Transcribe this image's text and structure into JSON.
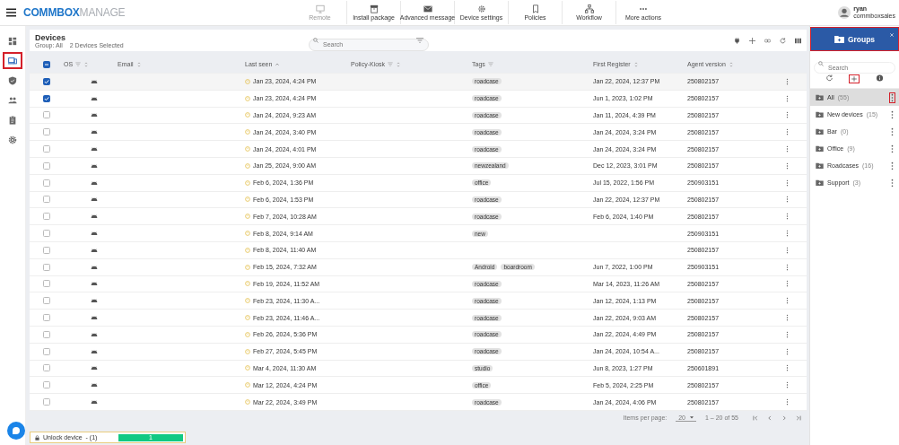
{
  "app": {
    "logo_bold": "COMMBOX",
    "logo_light": "MANAGE"
  },
  "toolbar": [
    {
      "label": "Remote",
      "disabled": true
    },
    {
      "label": "Install package",
      "disabled": false
    },
    {
      "label": "Advanced message",
      "disabled": false
    },
    {
      "label": "Device settings",
      "disabled": false
    },
    {
      "label": "Policies",
      "disabled": false
    },
    {
      "label": "Workflow",
      "disabled": false
    },
    {
      "label": "More actions",
      "disabled": false
    }
  ],
  "user": {
    "name": "ryan",
    "account": "commboxsales"
  },
  "nav": [
    {
      "selected": false,
      "highlighted": false
    },
    {
      "selected": true,
      "highlighted": true
    },
    {
      "selected": false,
      "highlighted": false
    },
    {
      "selected": false,
      "highlighted": false
    },
    {
      "selected": false,
      "highlighted": false
    },
    {
      "selected": false,
      "highlighted": false
    }
  ],
  "header": {
    "title": "Devices",
    "group": "Group: All",
    "selection": "2 Devices Selected",
    "search_placeholder": "Search"
  },
  "table": {
    "all_indeterminate": true,
    "columns": [
      {
        "label": "OS",
        "filter": true,
        "sortable": true,
        "sorted": false
      },
      {
        "label": "Email",
        "filter": false,
        "sortable": true,
        "sorted": false
      },
      {
        "label": "Last seen",
        "filter": false,
        "sortable": true,
        "sorted": true
      },
      {
        "label": "Policy-Kiosk",
        "filter": true,
        "sortable": true,
        "sorted": false
      },
      {
        "label": "Tags",
        "filter": true,
        "sortable": false,
        "sorted": false
      },
      {
        "label": "First Register",
        "filter": false,
        "sortable": true,
        "sorted": false
      },
      {
        "label": "Agent version",
        "filter": false,
        "sortable": true,
        "sorted": false
      }
    ],
    "rows": [
      {
        "checked": true,
        "last_seen": "Jan 23, 2024, 4:24 PM",
        "tags": [
          "roadcase"
        ],
        "first_register": "Jan 22, 2024, 12:37 PM",
        "agent_version": "250802157"
      },
      {
        "checked": true,
        "last_seen": "Jan 23, 2024, 4:24 PM",
        "tags": [
          "roadcase"
        ],
        "first_register": "Jun 1, 2023, 1:02 PM",
        "agent_version": "250802157"
      },
      {
        "checked": false,
        "last_seen": "Jan 24, 2024, 9:23 AM",
        "tags": [
          "roadcase"
        ],
        "first_register": "Jan 11, 2024, 4:39 PM",
        "agent_version": "250802157"
      },
      {
        "checked": false,
        "last_seen": "Jan 24, 2024, 3:40 PM",
        "tags": [
          "roadcase"
        ],
        "first_register": "Jan 24, 2024, 3:24 PM",
        "agent_version": "250802157"
      },
      {
        "checked": false,
        "last_seen": "Jan 24, 2024, 4:01 PM",
        "tags": [
          "roadcase"
        ],
        "first_register": "Jan 24, 2024, 3:24 PM",
        "agent_version": "250802157"
      },
      {
        "checked": false,
        "last_seen": "Jan 25, 2024, 9:00 AM",
        "tags": [
          "newzealand"
        ],
        "first_register": "Dec 12, 2023, 3:01 PM",
        "agent_version": "250802157"
      },
      {
        "checked": false,
        "last_seen": "Feb 6, 2024, 1:36 PM",
        "tags": [
          "office"
        ],
        "first_register": "Jul 15, 2022, 1:56 PM",
        "agent_version": "250903151"
      },
      {
        "checked": false,
        "last_seen": "Feb 6, 2024, 1:53 PM",
        "tags": [
          "roadcase"
        ],
        "first_register": "Jan 22, 2024, 12:37 PM",
        "agent_version": "250802157"
      },
      {
        "checked": false,
        "last_seen": "Feb 7, 2024, 10:28 AM",
        "tags": [
          "roadcase"
        ],
        "first_register": "Feb 6, 2024, 1:40 PM",
        "agent_version": "250802157"
      },
      {
        "checked": false,
        "last_seen": "Feb 8, 2024, 9:14 AM",
        "tags": [
          "new"
        ],
        "agent_version": "250903151"
      },
      {
        "checked": false,
        "last_seen": "Feb 8, 2024, 11:40 AM",
        "tags": [],
        "agent_version": "250802157"
      },
      {
        "checked": false,
        "last_seen": "Feb 15, 2024, 7:32 AM",
        "tags": [
          "Android",
          "boardroom"
        ],
        "first_register": "Jun 7, 2022, 1:00 PM",
        "agent_version": "250903151"
      },
      {
        "checked": false,
        "last_seen": "Feb 19, 2024, 11:52 AM",
        "tags": [
          "roadcase"
        ],
        "first_register": "Mar 14, 2023, 11:26 AM",
        "agent_version": "250802157"
      },
      {
        "checked": false,
        "last_seen": "Feb 23, 2024, 11:30 A...",
        "tags": [
          "roadcase"
        ],
        "first_register": "Jan 12, 2024, 1:13 PM",
        "agent_version": "250802157"
      },
      {
        "checked": false,
        "last_seen": "Feb 23, 2024, 11:46 A...",
        "tags": [
          "roadcase"
        ],
        "first_register": "Jan 22, 2024, 9:03 AM",
        "agent_version": "250802157"
      },
      {
        "checked": false,
        "last_seen": "Feb 26, 2024, 5:36 PM",
        "tags": [
          "roadcase"
        ],
        "first_register": "Jan 22, 2024, 4:49 PM",
        "agent_version": "250802157"
      },
      {
        "checked": false,
        "last_seen": "Feb 27, 2024, 5:45 PM",
        "tags": [
          "roadcase"
        ],
        "first_register": "Jan 24, 2024, 10:54 A...",
        "agent_version": "250802157"
      },
      {
        "checked": false,
        "last_seen": "Mar 4, 2024, 11:30 AM",
        "tags": [
          "studio"
        ],
        "first_register": "Jun 8, 2023, 1:27 PM",
        "agent_version": "250601891"
      },
      {
        "checked": false,
        "last_seen": "Mar 12, 2024, 4:24 PM",
        "tags": [
          "office"
        ],
        "first_register": "Feb 5, 2024, 2:25 PM",
        "agent_version": "250802157"
      },
      {
        "checked": false,
        "last_seen": "Mar 22, 2024, 3:49 PM",
        "tags": [
          "roadcase"
        ],
        "first_register": "Jan 24, 2024, 4:06 PM",
        "agent_version": "250802157"
      }
    ]
  },
  "pagination": {
    "items_label": "Items per page:",
    "per_page": "20",
    "range": "1 – 20 of 55"
  },
  "groups": {
    "title": "Groups",
    "highlighted": true,
    "search_placeholder": "Search",
    "add_highlighted": true,
    "items": [
      {
        "name": "All",
        "count": "(55)",
        "selected": true,
        "menu_highlighted": true
      },
      {
        "name": "New devices",
        "count": "(15)",
        "selected": false,
        "menu_highlighted": false
      },
      {
        "name": "Bar",
        "count": "(0)",
        "selected": false,
        "menu_highlighted": false
      },
      {
        "name": "Office",
        "count": "(9)",
        "selected": false,
        "menu_highlighted": false
      },
      {
        "name": "Roadcases",
        "count": "(16)",
        "selected": false,
        "menu_highlighted": false
      },
      {
        "name": "Support",
        "count": "(3)",
        "selected": false,
        "menu_highlighted": false
      }
    ]
  },
  "task": {
    "label": "Unlock device",
    "count": "- (1)",
    "level": 1,
    "progress_text": "1"
  }
}
